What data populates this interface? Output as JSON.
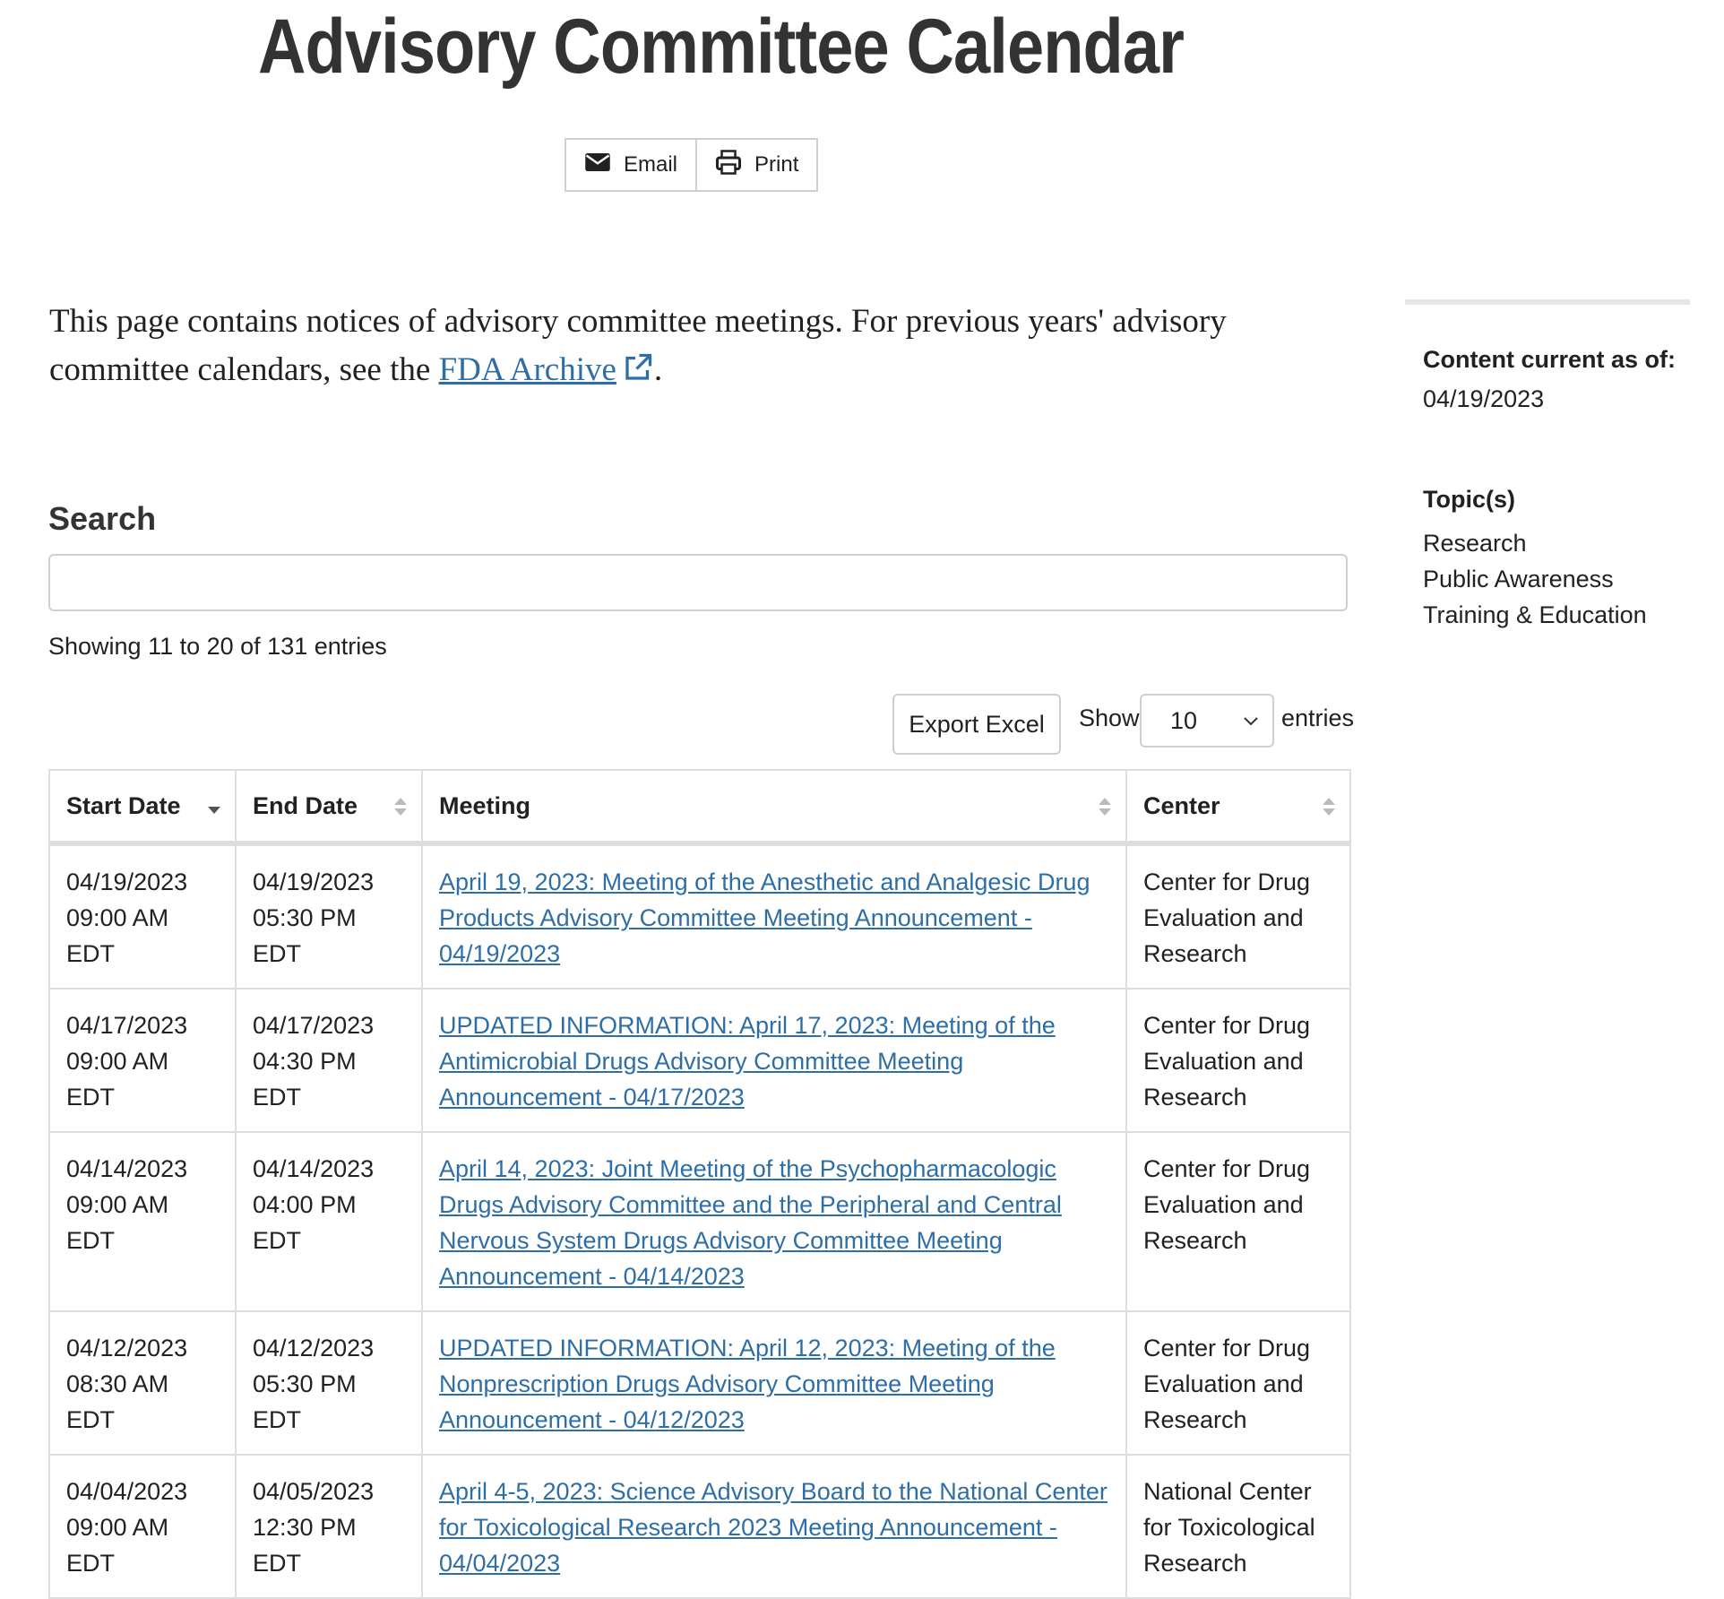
{
  "page": {
    "title": "Advisory Committee Calendar",
    "share": {
      "email_label": "Email",
      "print_label": "Print"
    },
    "intro": {
      "text_before": "This page contains notices of advisory committee meetings. For previous years' advisory committee calendars, see the ",
      "link_text": "FDA Archive",
      "text_after": "."
    }
  },
  "search": {
    "label": "Search",
    "value": ""
  },
  "table_info": {
    "showing": "Showing 11 to 20 of 131 entries"
  },
  "controls": {
    "export_label": "Export Excel",
    "show_label": "Show",
    "page_size": "10",
    "entries_label": "entries"
  },
  "table": {
    "columns": [
      "Start Date",
      "End Date",
      "Meeting",
      "Center"
    ],
    "rows": [
      {
        "start_date": "04/19/2023",
        "start_time": "09:00 AM EDT",
        "end_date": "04/19/2023",
        "end_time": "05:30 PM EDT",
        "meeting": "April 19, 2023: Meeting of the Anesthetic and Analgesic Drug Products Advisory Committee Meeting Announcement - 04/19/2023",
        "center": "Center for Drug Evaluation and Research"
      },
      {
        "start_date": "04/17/2023",
        "start_time": "09:00 AM EDT",
        "end_date": "04/17/2023",
        "end_time": "04:30 PM EDT",
        "meeting": "UPDATED INFORMATION: April 17, 2023: Meeting of the Antimicrobial Drugs Advisory Committee Meeting Announcement - 04/17/2023",
        "center": "Center for Drug Evaluation and Research"
      },
      {
        "start_date": "04/14/2023",
        "start_time": "09:00 AM EDT",
        "end_date": "04/14/2023",
        "end_time": "04:00 PM EDT",
        "meeting": "April 14, 2023: Joint Meeting of the Psychopharmacologic Drugs Advisory Committee and the Peripheral and Central Nervous System Drugs Advisory Committee Meeting Announcement - 04/14/2023",
        "center": "Center for Drug Evaluation and Research"
      },
      {
        "start_date": "04/12/2023",
        "start_time": "08:30 AM EDT",
        "end_date": "04/12/2023",
        "end_time": "05:30 PM EDT",
        "meeting": "UPDATED INFORMATION: April 12, 2023: Meeting of the Nonprescription Drugs Advisory Committee Meeting Announcement - 04/12/2023",
        "center": "Center for Drug Evaluation and Research"
      },
      {
        "start_date": "04/04/2023",
        "start_time": "09:00 AM EDT",
        "end_date": "04/05/2023",
        "end_time": "12:30 PM EDT",
        "meeting": "April 4-5, 2023: Science Advisory Board to the National Center for Toxicological Research 2023 Meeting Announcement - 04/04/2023",
        "center": "National Center for Toxicological Research"
      }
    ]
  },
  "sidebar": {
    "content_current_label": "Content current as of:",
    "content_current_date": "04/19/2023",
    "topics_label": "Topic(s)",
    "topics": [
      "Research",
      "Public Awareness",
      "Training & Education"
    ]
  },
  "colors": {
    "link": "#2e6ea6",
    "text": "#212121",
    "border": "#dedede"
  },
  "icons": {
    "email": "envelope-icon",
    "print": "printer-icon",
    "external": "external-link-icon",
    "dropdown": "chevron-down-icon"
  }
}
